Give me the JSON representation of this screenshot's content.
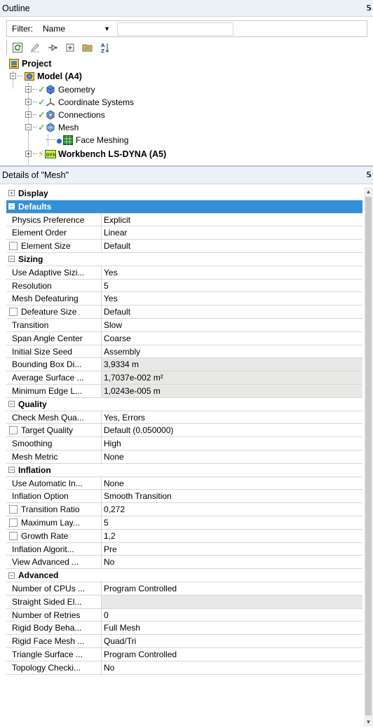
{
  "outline": {
    "title": "Outline",
    "filter_label": "Filter:",
    "filter_value": "Name",
    "tree": {
      "project": "Project",
      "model": "Model (A4)",
      "geometry": "Geometry",
      "coordinate_systems": "Coordinate Systems",
      "connections": "Connections",
      "mesh": "Mesh",
      "face_meshing": "Face Meshing",
      "workbench": "Workbench LS-DYNA (A5)"
    }
  },
  "details": {
    "title": "Details of \"Mesh\"",
    "sections": {
      "display": "Display",
      "defaults": "Defaults",
      "sizing": "Sizing",
      "quality": "Quality",
      "inflation": "Inflation",
      "advanced": "Advanced"
    },
    "rows": {
      "physics_preference": {
        "label": "Physics Preference",
        "value": "Explicit"
      },
      "element_order": {
        "label": "Element Order",
        "value": "Linear"
      },
      "element_size": {
        "label": "Element Size",
        "value": "Default"
      },
      "use_adaptive_sizing": {
        "label": "Use Adaptive Sizi...",
        "value": "Yes"
      },
      "resolution": {
        "label": "Resolution",
        "value": "5"
      },
      "mesh_defeaturing": {
        "label": "Mesh Defeaturing",
        "value": "Yes"
      },
      "defeature_size": {
        "label": "Defeature Size",
        "value": "Default"
      },
      "transition": {
        "label": "Transition",
        "value": "Slow"
      },
      "span_angle_center": {
        "label": "Span Angle Center",
        "value": "Coarse"
      },
      "initial_size_seed": {
        "label": "Initial Size Seed",
        "value": "Assembly"
      },
      "bounding_box": {
        "label": "Bounding Box Di...",
        "value": "3,9334 m"
      },
      "average_surface": {
        "label": "Average Surface ...",
        "value": "1,7037e-002 m²"
      },
      "minimum_edge": {
        "label": "Minimum Edge L...",
        "value": "1,0243e-005 m"
      },
      "check_mesh_quality": {
        "label": "Check Mesh Qua...",
        "value": "Yes, Errors"
      },
      "target_quality": {
        "label": "Target Quality",
        "value": "Default (0.050000)"
      },
      "smoothing": {
        "label": "Smoothing",
        "value": "High"
      },
      "mesh_metric": {
        "label": "Mesh Metric",
        "value": "None"
      },
      "use_automatic_inflation": {
        "label": "Use Automatic In...",
        "value": "None"
      },
      "inflation_option": {
        "label": "Inflation Option",
        "value": "Smooth Transition"
      },
      "transition_ratio": {
        "label": "Transition Ratio",
        "value": "0,272"
      },
      "maximum_layers": {
        "label": "Maximum Lay...",
        "value": "5"
      },
      "growth_rate": {
        "label": "Growth Rate",
        "value": "1,2"
      },
      "inflation_algorithm": {
        "label": "Inflation Algorit...",
        "value": "Pre"
      },
      "view_advanced": {
        "label": "View Advanced ...",
        "value": "No"
      },
      "number_of_cpus": {
        "label": "Number of CPUs ...",
        "value": "Program Controlled"
      },
      "straight_sided": {
        "label": "Straight Sided El...",
        "value": ""
      },
      "number_of_retries": {
        "label": "Number of Retries",
        "value": "0"
      },
      "rigid_body_behavior": {
        "label": "Rigid Body Beha...",
        "value": "Full Mesh"
      },
      "rigid_face_mesh": {
        "label": "Rigid Face Mesh ...",
        "value": "Quad/Tri"
      },
      "triangle_surface": {
        "label": "Triangle Surface ...",
        "value": "Program Controlled"
      },
      "topology_checking": {
        "label": "Topology Checki...",
        "value": "No"
      }
    }
  },
  "colors": {
    "selected_row": "#3390d8",
    "header_bg": "#ecf1f8",
    "readonly_cell": "#e8e8e6"
  }
}
